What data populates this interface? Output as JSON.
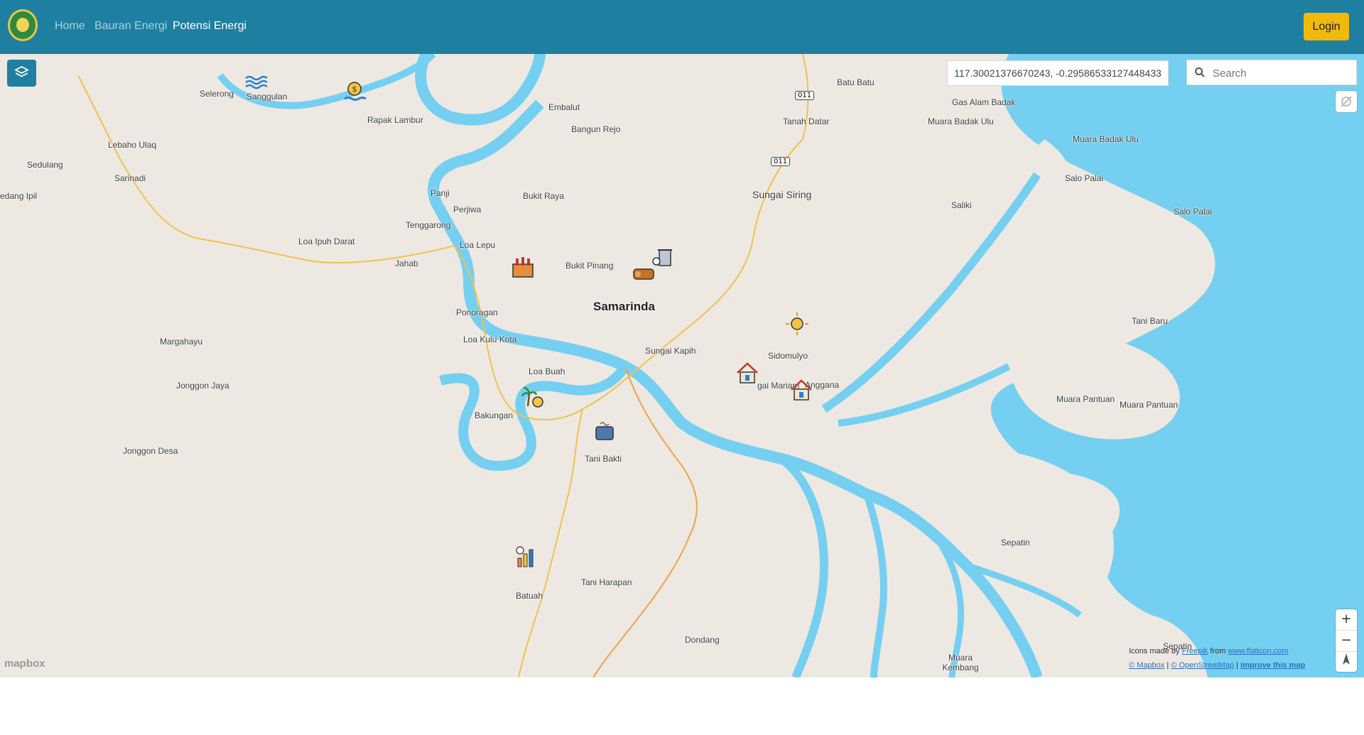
{
  "navbar": {
    "links": [
      "Home",
      "Bauran Energi",
      "Potensi Energi"
    ],
    "login_label": "Login"
  },
  "map": {
    "coordinates": "117.30021376670243, -0.29586533127448433",
    "search_placeholder": "Search",
    "zoom_in": "+",
    "zoom_out": "−",
    "places": {
      "selerong": "Selerong",
      "sanggulan": "Sanggulan",
      "rapak_lambur": "Rapak Lambur",
      "embalut": "Embalut",
      "bangun_rejo": "Bangun Rejo",
      "batu_batu": "Batu Batu",
      "gas_alam_badak": "Gas Alam Badak",
      "muara_badak_ulu_1": "Muara Badak Ulu",
      "muara_badak_ulu_2": "Muara Badak Ulu",
      "tanah_datar": "Tanah Datar",
      "lebaho_ulaq": "Lebaho Ulaq",
      "sedulang": "Sedulang",
      "sarinadi": "Sarinadi",
      "edang_ipil": "edang Ipil",
      "panji": "Panji",
      "perjiwa": "Perjiwa",
      "bukit_raya": "Bukit Raya",
      "tenggarong": "Tenggarong",
      "loa_ipuh_darat": "Loa Ipuh Darat",
      "loa_lepu": "Loa Lepu",
      "jahab": "Jahab",
      "bukit_pinang": "Bukit Pinang",
      "sungai_siring": "Sungai Siring",
      "saliki": "Saliki",
      "salo_palai_1": "Salo Palai",
      "salo_palai_2": "Salo Palai",
      "samarinda": "Samarinda",
      "ponoragan": "Ponoragan",
      "loa_kulu_kota": "Loa Kulu Kota",
      "margahayu": "Margahayu",
      "sungai_kapih": "Sungai Kapih",
      "sidomulyo": "Sidomulyo",
      "tani_baru": "Tani Baru",
      "loa_buah": "Loa Buah",
      "jonggon_jaya": "Jonggon Jaya",
      "sungai_mariam": "gai Mariam",
      "anggana": "Anggana",
      "bakungan": "Bakungan",
      "muara_pantuan_1": "Muara Pantuan",
      "muara_pantuan_2": "Muara Pantuan",
      "jonggon_desa": "Jonggon Desa",
      "tani_bakti": "Tani Bakti",
      "sepatin": "Sepatin",
      "tani_harapan": "Tani Harapan",
      "batuah": "Batuah",
      "dondang": "Dondang",
      "sepatin_2": "Sepatin",
      "muara_kembang": "Muara Kembang"
    },
    "road_shields": [
      "011",
      "011"
    ],
    "markers": [
      "water-energy-icon",
      "hydro-dam-icon",
      "factory-icon",
      "biomass-waste-icon",
      "log-biomass-icon",
      "solar-icon",
      "house-energy-icon",
      "house-energy-icon",
      "palm-oil-icon",
      "biogas-pot-icon",
      "energy-chart-icon"
    ],
    "attribution": {
      "icons_made_by": "Icons made by",
      "freepik": "Freepik",
      "from": "from",
      "flaticon": "www.flaticon.com",
      "mapbox": "© Mapbox",
      "osm": "© OpenStreetMap",
      "improve": "Improve this map"
    },
    "mapbox_logo": "mapbox"
  },
  "colors": {
    "navbar": "#1f7fa1",
    "login": "#f2b90d",
    "water": "#75cff0",
    "land": "#ede9e2"
  }
}
